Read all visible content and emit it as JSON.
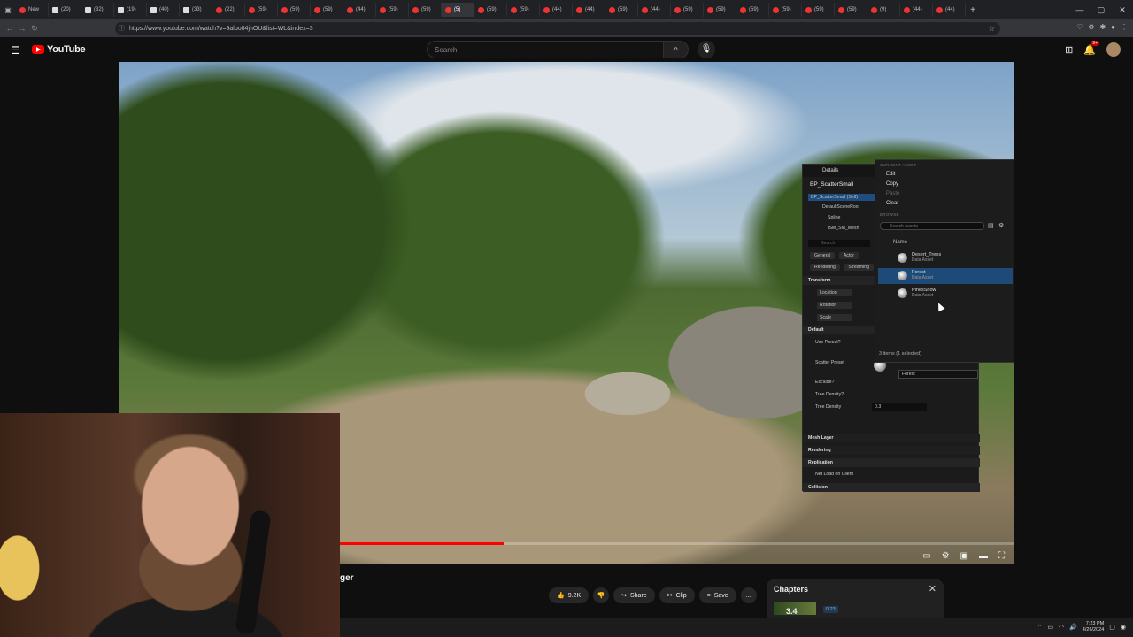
{
  "browser": {
    "tabs": [
      {
        "label": "New"
      },
      {
        "label": "(20)"
      },
      {
        "label": "(32)"
      },
      {
        "label": "(19)"
      },
      {
        "label": "(40)"
      },
      {
        "label": "(33)"
      },
      {
        "label": "(22)"
      },
      {
        "label": "(59)"
      },
      {
        "label": "(59)"
      },
      {
        "label": "(59)"
      },
      {
        "label": "(44)"
      },
      {
        "label": "(59)"
      },
      {
        "label": "(59)"
      },
      {
        "label": "(5)"
      },
      {
        "label": "(59)"
      },
      {
        "label": "(59)"
      },
      {
        "label": "(44)"
      },
      {
        "label": "(44)"
      },
      {
        "label": "(59)"
      },
      {
        "label": "(44)"
      },
      {
        "label": "(59)"
      },
      {
        "label": "(59)"
      },
      {
        "label": "(59)"
      },
      {
        "label": "(59)"
      },
      {
        "label": "(59)"
      },
      {
        "label": "(59)"
      },
      {
        "label": "(9)"
      },
      {
        "label": "(44)"
      },
      {
        "label": "(44)"
      }
    ],
    "active_tab_index": 13,
    "url": "https://www.youtube.com/watch?v=9albo84jhOU&list=WL&index=3"
  },
  "youtube": {
    "logo_text": "YouTube",
    "search_placeholder": "Search",
    "notification_count": "9+"
  },
  "player": {
    "progress_fraction": 0.43
  },
  "unreal": {
    "details_tab": "Details",
    "actor_name": "BP_ScatterSmall",
    "tree": [
      {
        "label": "BP_ScatterSmall (Self)",
        "selected": true
      },
      {
        "label": "DefaultSceneRoot"
      },
      {
        "label": "Spline"
      },
      {
        "label": "ISM_SM_Mesh"
      }
    ],
    "details_search": "Search",
    "filter_tabs": [
      "General",
      "Actor",
      "Rendering",
      "Streaming"
    ],
    "sections": {
      "transform": "Transform",
      "location": "Location",
      "rotation": "Rotation",
      "scale": "Scale",
      "default": "Default",
      "use_preset": "Use Preset?",
      "scatter_preset": "Scatter Preset",
      "scatter_preset_value": "Forest",
      "exclude": "Exclude?",
      "tree_density_toggle": "Tree Density?",
      "tree_density": "Tree Density",
      "tree_density_value": "0.3",
      "mesh_layer": "Mesh Layer",
      "rendering": "Rendering",
      "replication": "Replication",
      "net_load": "Net Load on Client",
      "collision": "Collision"
    },
    "dropdown": {
      "current_asset_header": "CURRENT ASSET",
      "edit": "Edit",
      "copy": "Copy",
      "paste": "Paste",
      "clear": "Clear",
      "browse_header": "BROWSE",
      "search_placeholder": "Search Assets",
      "column_name": "Name",
      "assets": [
        {
          "name": "Desert_Trees",
          "type": "Data Asset",
          "selected": false
        },
        {
          "name": "Forest",
          "type": "Data Asset",
          "selected": true
        },
        {
          "name": "PinesSnow",
          "type": "Data Asset",
          "selected": false
        }
      ],
      "footer": "3 items (1 selected)"
    }
  },
  "video": {
    "title_fragment": "ger",
    "likes": "9.2K",
    "share": "Share",
    "clip": "Clip",
    "save": "Save",
    "more": "..."
  },
  "chapters": {
    "title": "Chapters",
    "first_thumb_text": "3.4",
    "first_timestamp": "0:23"
  },
  "taskbar": {
    "time": "7:23 PM",
    "date": "4/26/2024"
  },
  "colors": {
    "youtube_red": "#ff0000",
    "selection_blue": "#1e4a78",
    "background": "#0f0f0f"
  }
}
